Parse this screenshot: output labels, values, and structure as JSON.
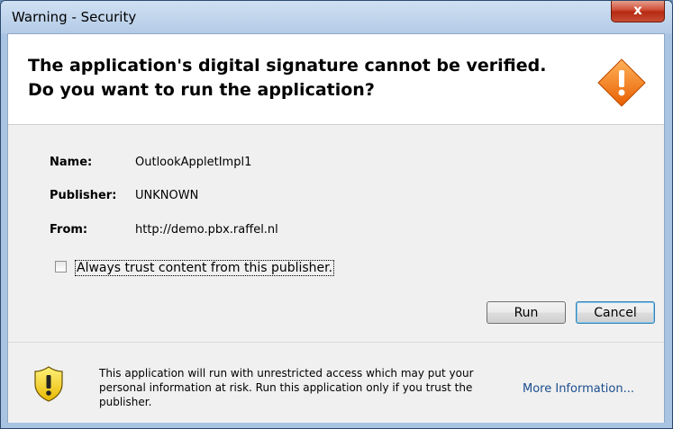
{
  "window": {
    "title": "Warning - Security",
    "close_label": "x"
  },
  "header": {
    "line1": "The application's digital signature cannot be verified.",
    "line2": "Do you want to run the application?",
    "icon": "warning-diamond-icon"
  },
  "details": {
    "name_label": "Name:",
    "name_value": "OutlookAppletImpl1",
    "publisher_label": "Publisher:",
    "publisher_value": "UNKNOWN",
    "from_label": "From:",
    "from_value": "http://demo.pbx.raffel.nl"
  },
  "trust_checkbox": {
    "label": "Always trust content from this publisher.",
    "checked": false
  },
  "buttons": {
    "run": "Run",
    "cancel": "Cancel"
  },
  "footer": {
    "icon": "shield-warning-icon",
    "message": "This application will run with unrestricted access which may put your personal information at risk. Run this application only if you trust the publisher.",
    "more_info": "More Information..."
  },
  "colors": {
    "close_button": "#c94c35",
    "warning_orange": "#f07d1a",
    "shield_yellow": "#f5d214",
    "link": "#1a4d8f"
  }
}
